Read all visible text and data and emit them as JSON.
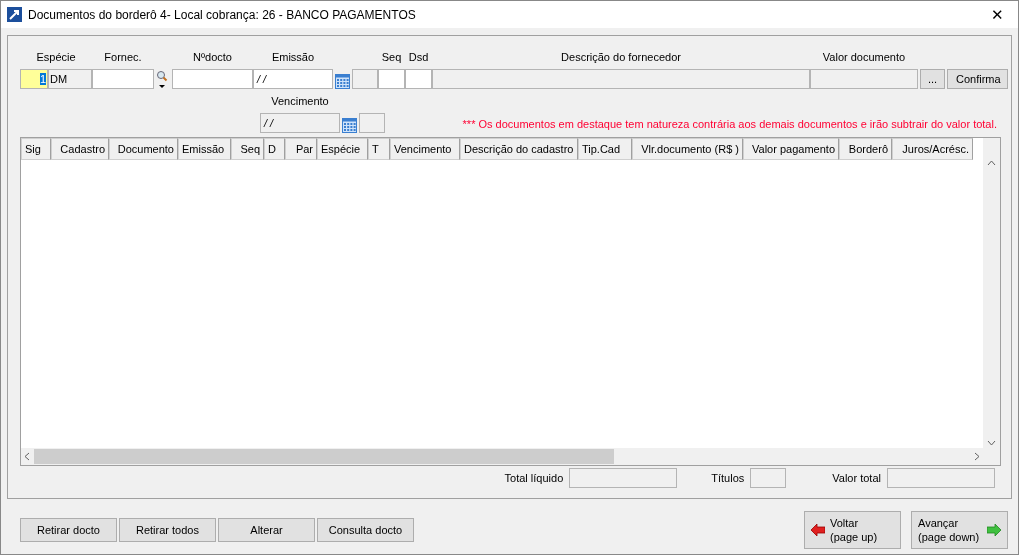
{
  "window": {
    "title": "Documentos do borderô 4- Local cobrança: 26 - BANCO PAGAMENTOS",
    "close": "✕"
  },
  "form": {
    "especie": {
      "label": "Espécie",
      "code": "1",
      "code_selected": true,
      "type": "DM"
    },
    "fornec": {
      "label": "Fornec."
    },
    "nrdocto": {
      "label": "Nºdocto"
    },
    "emissao": {
      "label": "Emissão",
      "value": "/ /"
    },
    "seq": {
      "label": "Seq"
    },
    "dsd": {
      "label": "Dsd"
    },
    "descricao": {
      "label": "Descrição do fornecedor"
    },
    "valor": {
      "label": "Valor documento"
    },
    "more_button": "...",
    "confirm_button": "Confirma",
    "vencimento": {
      "label": "Vencimento",
      "value": "/ /"
    },
    "note": "*** Os documentos em destaque tem natureza contrária aos demais documentos e irão subtrair do valor total."
  },
  "table": {
    "columns": [
      {
        "label": "Sig"
      },
      {
        "label": "Cadastro"
      },
      {
        "label": "Documento"
      },
      {
        "label": "Emissão"
      },
      {
        "label": "Seq"
      },
      {
        "label": "D"
      },
      {
        "label": "Par"
      },
      {
        "label": "Espécie"
      },
      {
        "label": "T"
      },
      {
        "label": "Vencimento"
      },
      {
        "label": "Descrição do cadastro"
      },
      {
        "label": "Tip.Cad"
      },
      {
        "label": "Vlr.documento (R$ )"
      },
      {
        "label": "Valor pagamento"
      },
      {
        "label": "Borderô"
      },
      {
        "label": "Juros/Acrésc."
      }
    ]
  },
  "totals": {
    "total_liquido": "Total líquido",
    "titulos": "Títulos",
    "valor_total": "Valor total"
  },
  "buttons": [
    {
      "label": "Retirar docto"
    },
    {
      "label": "Retirar todos"
    },
    {
      "label": "Alterar"
    },
    {
      "label": "Consulta docto"
    }
  ],
  "nav": [
    {
      "label": "Voltar",
      "sub": "(page up)",
      "kind": "back"
    },
    {
      "label": "Avançar",
      "sub": "(page down)",
      "kind": "forward"
    }
  ]
}
